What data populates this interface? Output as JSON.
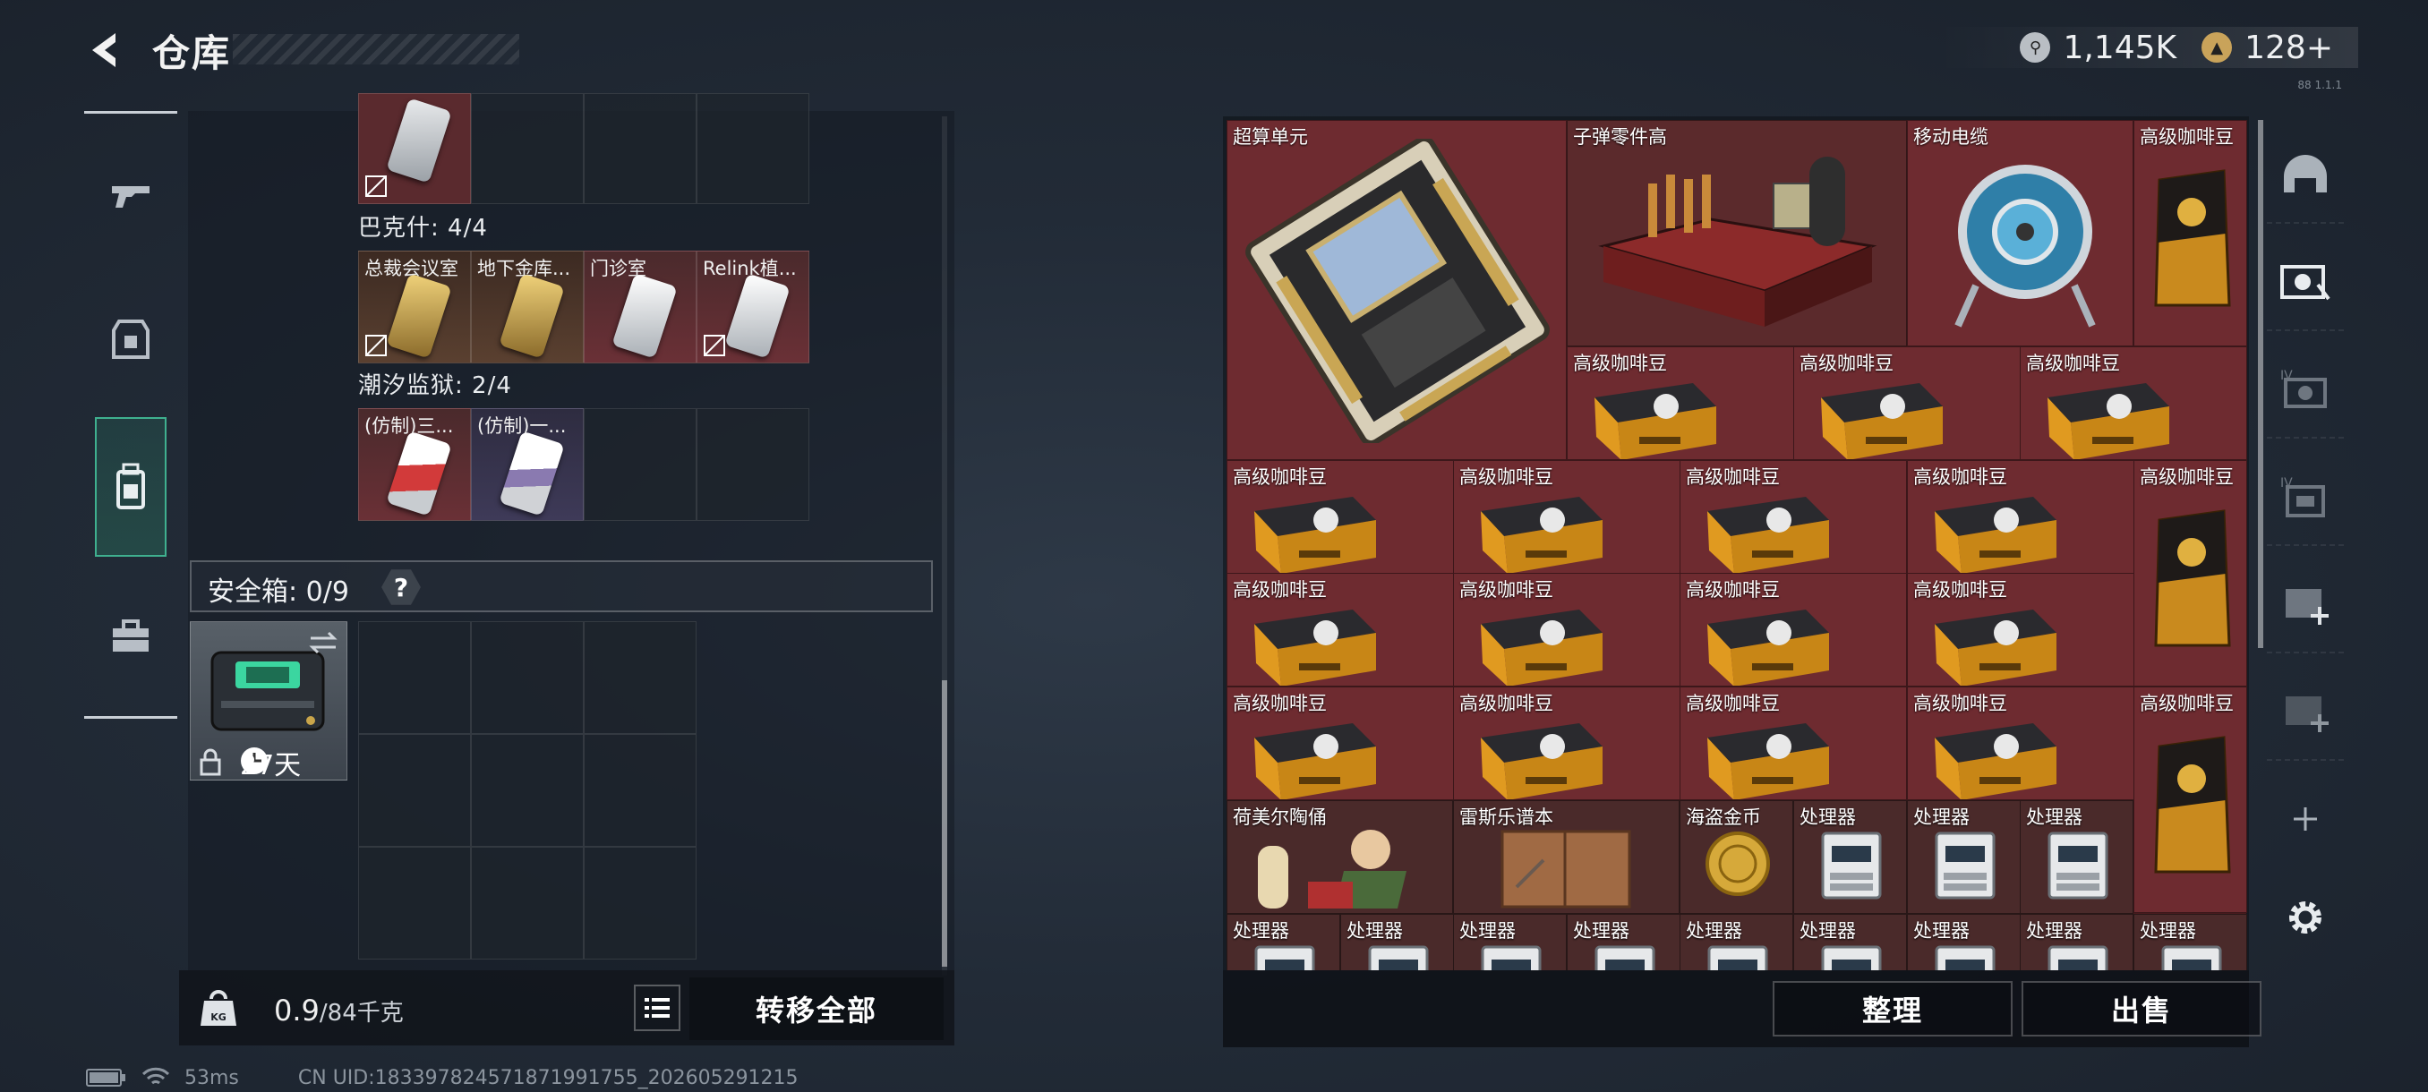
{
  "header": {
    "title": "仓库",
    "currencies": [
      {
        "icon": "silver-coin-icon",
        "value": "1,145K",
        "color": "#b9bec4"
      },
      {
        "icon": "gold-coin-icon",
        "value": "128+",
        "color": "#c9a35a"
      }
    ]
  },
  "left_rail": {
    "items": [
      {
        "name": "weapons",
        "icon": "gun-icon"
      },
      {
        "name": "armor",
        "icon": "armor-icon"
      },
      {
        "name": "backpack",
        "icon": "backpack-icon",
        "active": true
      },
      {
        "name": "toolbox",
        "icon": "toolbox-icon"
      }
    ]
  },
  "inventory": {
    "sections": [
      {
        "label": "巴克什: 4/4",
        "cards": [
          {
            "label": "总裁会议室",
            "color": "#c9a64a"
          },
          {
            "label": "地下金库...",
            "color": "#c9a64a"
          },
          {
            "label": "门诊室",
            "color": "#dfe2e4"
          },
          {
            "label": "Relink植...",
            "color": "#dfe2e4"
          }
        ]
      },
      {
        "label": "潮汐监狱: 2/4",
        "cards": [
          {
            "label": "(仿制)三...",
            "color": "#c94040"
          },
          {
            "label": "(仿制)一...",
            "color": "#9a8fb8"
          }
        ]
      }
    ],
    "safe": {
      "label": "安全箱: 0/9",
      "help": "?",
      "days": "27天"
    }
  },
  "bottom_left": {
    "weight_current": "0.9",
    "weight_total": "/84千克",
    "transfer_all": "转移全部"
  },
  "status": {
    "ping": "53ms",
    "uid": "CN UID:1833978245718719917​55_202605291215"
  },
  "container": {
    "items": [
      {
        "label": "超算单元",
        "kind": "supercomputer"
      },
      {
        "label": "子弹零件高",
        "kind": "ammo-parts"
      },
      {
        "label": "移动电缆",
        "kind": "cable-reel"
      },
      {
        "label": "高级咖啡豆",
        "kind": "coffee-bag"
      },
      {
        "label": "高级咖啡豆",
        "kind": "coffee-box"
      },
      {
        "label": "荷美尔陶俑",
        "kind": "figurine"
      },
      {
        "label": "雷斯乐谱本",
        "kind": "music-book"
      },
      {
        "label": "海盗金币",
        "kind": "pirate-coin"
      },
      {
        "label": "处理器",
        "kind": "processor"
      }
    ]
  },
  "actions": {
    "sort": "整理",
    "sell": "出售"
  },
  "right_rail": {
    "items": [
      {
        "icon": "helmet-slot-icon"
      },
      {
        "icon": "armor-card-icon"
      },
      {
        "icon": "armor-iv-icon"
      },
      {
        "icon": "backpack-iv-icon"
      },
      {
        "icon": "add-slot-icon"
      },
      {
        "icon": "add-slot-icon"
      },
      {
        "icon": "plus-icon"
      },
      {
        "icon": "gear-icon"
      }
    ]
  },
  "version": "88 1.1.1"
}
